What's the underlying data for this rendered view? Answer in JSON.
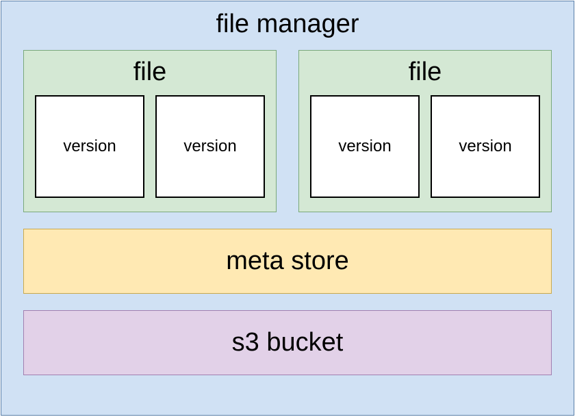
{
  "fileManager": {
    "title": "file manager",
    "files": [
      {
        "title": "file",
        "versions": [
          "version",
          "version"
        ]
      },
      {
        "title": "file",
        "versions": [
          "version",
          "version"
        ]
      }
    ],
    "metaStore": "meta store",
    "s3Bucket": "s3 bucket"
  },
  "colors": {
    "fileManagerBg": "#d0e1f4",
    "fileManagerBorder": "#5a7fa8",
    "fileBg": "#d4e8d4",
    "fileBorder": "#7aa87a",
    "versionBg": "#ffffff",
    "versionBorder": "#000000",
    "metaStoreBg": "#ffe9b3",
    "metaStoreBorder": "#c9a94d",
    "s3BucketBg": "#e2d1e8",
    "s3BucketBorder": "#a17fb0"
  }
}
